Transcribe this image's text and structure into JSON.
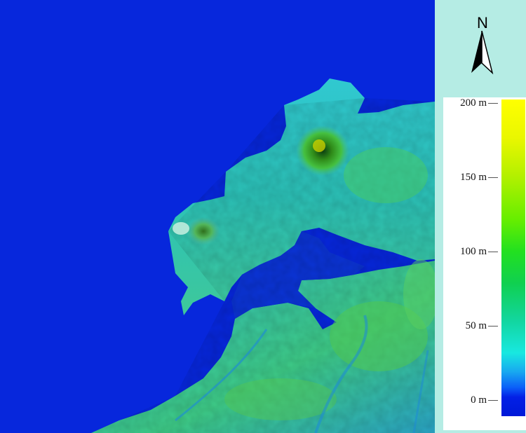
{
  "north_label": "N",
  "legend": {
    "ticks": [
      {
        "label": "200 m",
        "value": 200
      },
      {
        "label": "150 m",
        "value": 150
      },
      {
        "label": "100 m",
        "value": 100
      },
      {
        "label": "50 m",
        "value": 50
      },
      {
        "label": "0 m",
        "value": 0
      }
    ],
    "colors": {
      "high": "#ffff00",
      "mid": "#22e020",
      "low": "#18e8e0",
      "sea": "#0727dc"
    }
  },
  "icons": [
    "north-arrow-icon"
  ]
}
